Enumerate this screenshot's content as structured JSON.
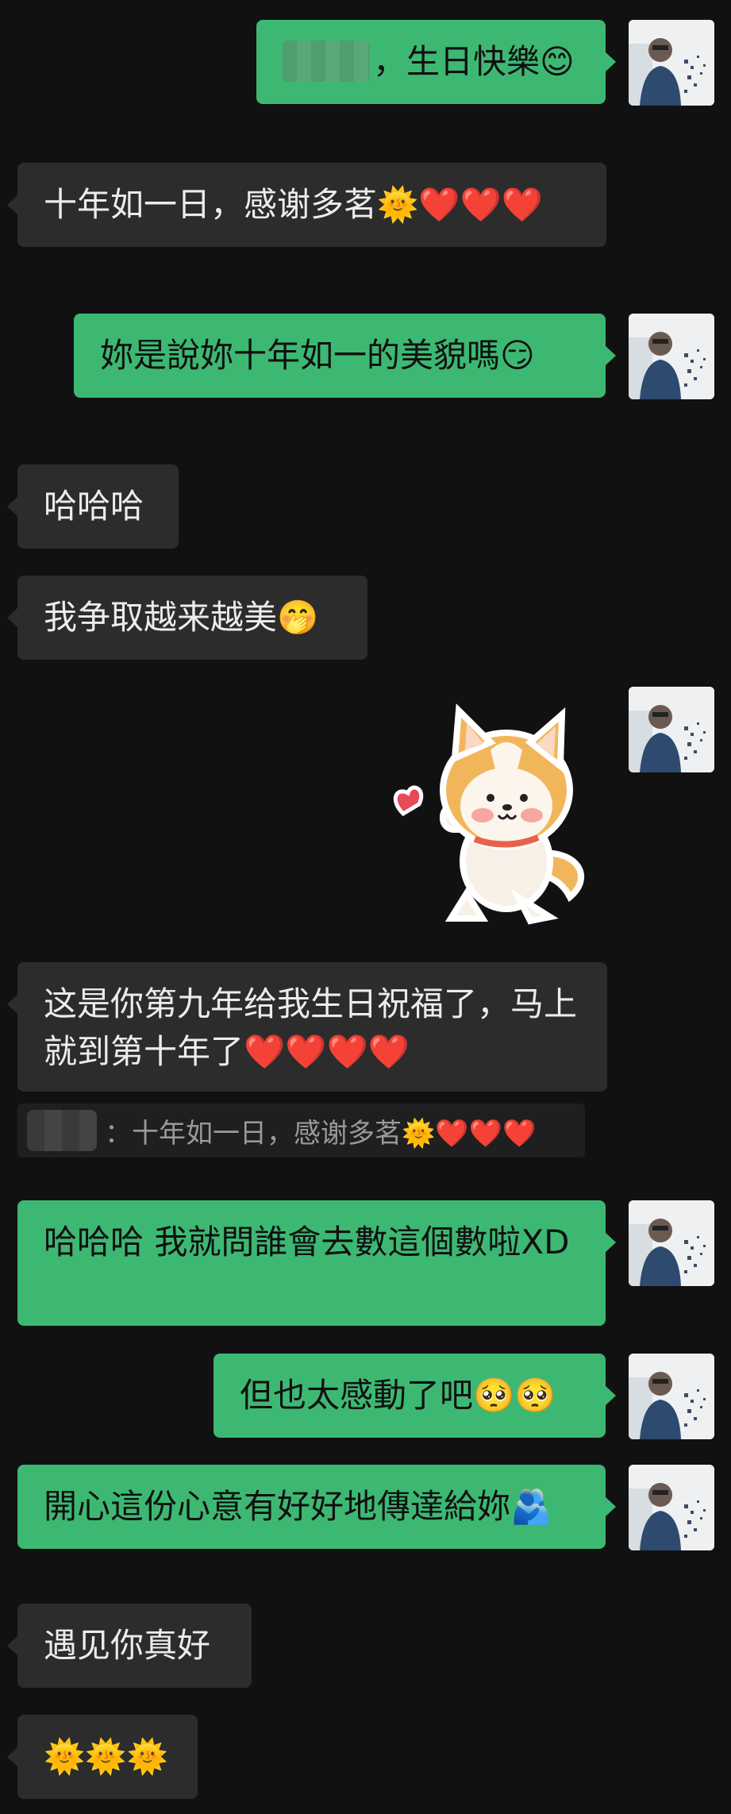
{
  "messages": [
    {
      "id": "m1",
      "sender": "me",
      "text": "，生日快樂😊",
      "redacted_name": true
    },
    {
      "id": "m2",
      "sender": "peer",
      "text": "十年如一日，感谢多茗🌞❤️❤️❤️"
    },
    {
      "id": "m3",
      "sender": "me",
      "text": "妳是說妳十年如一的美貌嗎😏"
    },
    {
      "id": "m4",
      "sender": "peer",
      "text": "哈哈哈"
    },
    {
      "id": "m5",
      "sender": "peer",
      "text": "我争取越来越美🤭"
    },
    {
      "id": "m6",
      "sender": "me",
      "sticker": "shiba-dog-heart-sticker"
    },
    {
      "id": "m7",
      "sender": "peer",
      "text": "这是你第九年给我生日祝福了，马上就到第十年了❤️❤️❤️❤️",
      "quote": {
        "text": "：十年如一日，感谢多茗🌞❤️❤️❤️",
        "redacted_name": true
      }
    },
    {
      "id": "m8",
      "sender": "me",
      "text": "哈哈哈  我就問誰會去數這個數啦XD"
    },
    {
      "id": "m9",
      "sender": "me",
      "text": "但也太感動了吧🥺🥺"
    },
    {
      "id": "m10",
      "sender": "me",
      "text": "開心這份心意有好好地傳達給妳🫂"
    },
    {
      "id": "m11",
      "sender": "peer",
      "text": "遇见你真好"
    },
    {
      "id": "m12",
      "sender": "peer",
      "text": "🌞🌞🌞"
    }
  ],
  "colors": {
    "background": "#111111",
    "me_bubble": "#3db873",
    "peer_bubble": "#2c2c2c"
  }
}
